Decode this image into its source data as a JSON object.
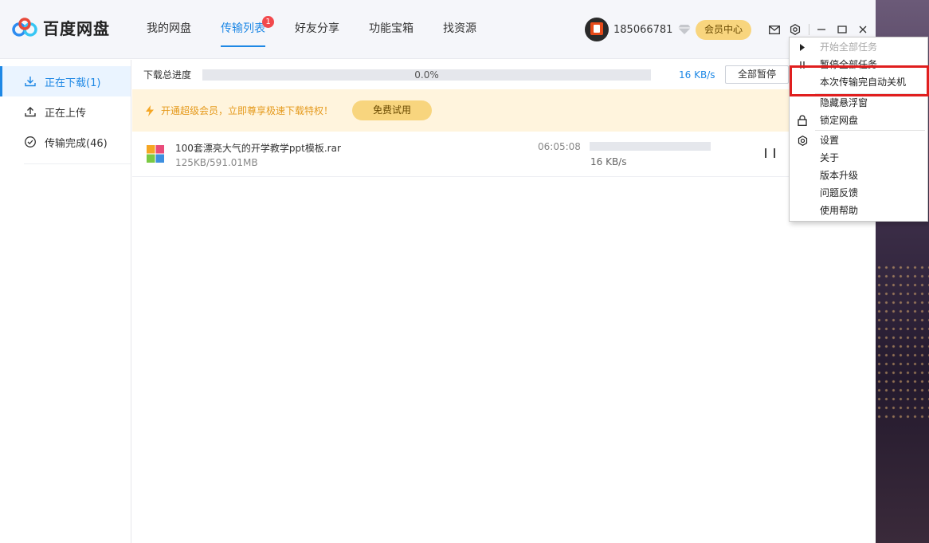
{
  "app": {
    "name": "百度网盘"
  },
  "nav": {
    "tabs": [
      {
        "label": "我的网盘"
      },
      {
        "label": "传输列表",
        "badge": "1"
      },
      {
        "label": "好友分享"
      },
      {
        "label": "功能宝箱"
      },
      {
        "label": "找资源"
      }
    ],
    "active_tab": "传输列表"
  },
  "user": {
    "name": "185066781",
    "vip_label": "会员中心"
  },
  "sidebar": {
    "items": [
      {
        "label": "正在下载(1)",
        "icon": "download-icon"
      },
      {
        "label": "正在上传",
        "icon": "upload-icon"
      },
      {
        "label": "传输完成(46)",
        "icon": "check-circle-icon"
      }
    ]
  },
  "progress": {
    "label": "下载总进度",
    "percent_text": "0.0%",
    "percent": 0,
    "speed": "16 KB/s",
    "pause_all": "全部暂停"
  },
  "banner": {
    "text": "开通超级会员，立即尊享极速下载特权！",
    "button": "免费试用"
  },
  "tasks": [
    {
      "name": "100套漂亮大气的开学教学ppt模板.rar",
      "size": "125KB/591.01MB",
      "time": "06:05:08",
      "speed": "16 KB/s",
      "progress": 0
    }
  ],
  "menu": {
    "items": [
      {
        "label": "开始全部任务",
        "disabled": true
      },
      {
        "label": "暂停全部任务"
      },
      {
        "label": "本次传输完自动关机"
      },
      {
        "label": "隐藏悬浮窗"
      },
      {
        "label": "锁定网盘"
      },
      {
        "label": "设置"
      },
      {
        "label": "关于"
      },
      {
        "label": "版本升级"
      },
      {
        "label": "问题反馈"
      },
      {
        "label": "使用帮助"
      }
    ]
  },
  "colors": {
    "accent": "#1e88e5",
    "vip": "#f8d57e",
    "highlight": "#e01e1e",
    "banner_bg": "#fff4dd"
  }
}
